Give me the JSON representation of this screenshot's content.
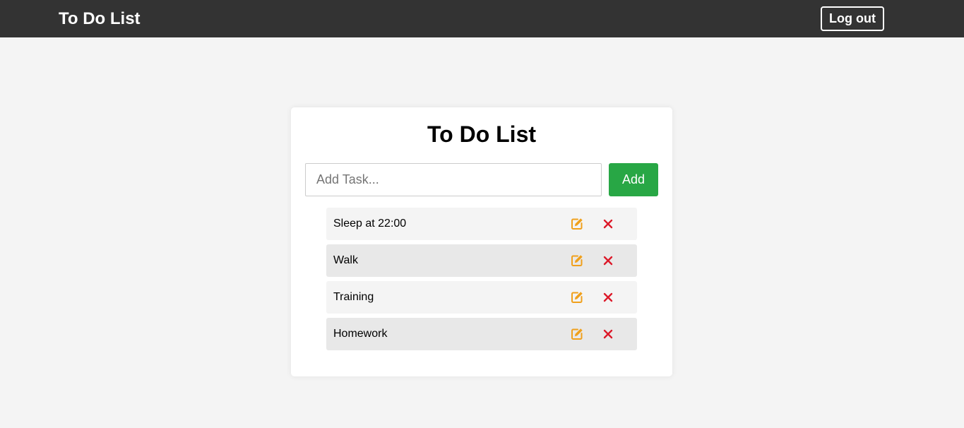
{
  "navbar": {
    "brand": "To Do List",
    "logout_label": "Log out"
  },
  "card": {
    "title": "To Do List",
    "input": {
      "placeholder": "Add Task...",
      "value": ""
    },
    "add_label": "Add"
  },
  "tasks": [
    {
      "text": "Sleep at 22:00"
    },
    {
      "text": "Walk"
    },
    {
      "text": "Training"
    },
    {
      "text": "Homework"
    }
  ],
  "icons": {
    "edit": "edit-icon",
    "delete": "close-icon"
  },
  "colors": {
    "navbar": "#333333",
    "add_button": "#28a745",
    "edit_icon": "#f0a01c",
    "delete_icon": "#dc1a2a"
  }
}
